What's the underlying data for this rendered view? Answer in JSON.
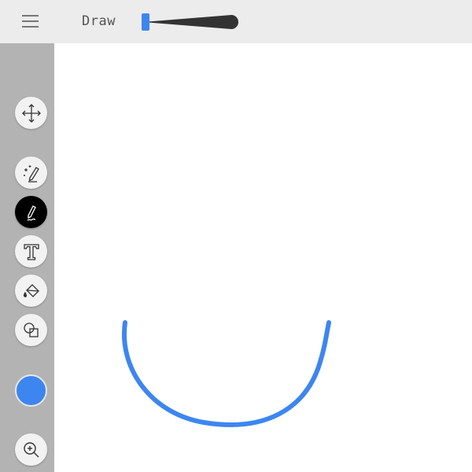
{
  "topbar": {
    "mode_label": "Draw",
    "menu_icon": "hamburger-menu-icon",
    "brush_size_value": 0.0
  },
  "toolbar": {
    "tools": [
      {
        "name": "move",
        "icon": "move-arrows-icon",
        "active": false
      },
      {
        "name": "magic-pen",
        "icon": "magic-pen-icon",
        "active": false
      },
      {
        "name": "pen",
        "icon": "pen-icon",
        "active": true
      },
      {
        "name": "text",
        "icon": "text-icon",
        "active": false
      },
      {
        "name": "fill",
        "icon": "paint-bucket-icon",
        "active": false
      },
      {
        "name": "shapes",
        "icon": "shapes-icon",
        "active": false
      }
    ],
    "zoom_icon": "zoom-in-icon"
  },
  "colors": {
    "current_color": "#3d86f0",
    "slider_handle": "#3d86f0",
    "stroke": "#3d86f0",
    "sidebar_bg": "#b3b3b3",
    "topbar_bg": "#ececec"
  }
}
